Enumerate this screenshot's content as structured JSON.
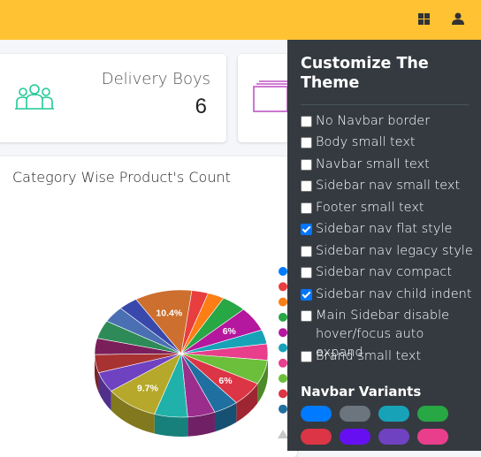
{
  "navbar": {
    "icons": [
      "apps-grid-icon",
      "user-icon"
    ],
    "color": "#ffc233"
  },
  "stats": [
    {
      "title": "Delivery Boys",
      "value": "6",
      "icon": "users-group-icon",
      "icon_color": "#20c997"
    },
    {
      "title": "",
      "value": "",
      "icon": "folder-stack-icon",
      "icon_color": "#c057c6"
    }
  ],
  "chart": {
    "title": "Category Wise Product's Count"
  },
  "chart_data": {
    "type": "pie",
    "title": "Category Wise Product's Count",
    "labels_shown": [
      "10.4%",
      "6%",
      "9.7%",
      "6%"
    ],
    "slices": [
      {
        "value": 10.4,
        "color": "#cd6f2e",
        "label": "10.4%"
      },
      {
        "value": 3.0,
        "color": "#e83e3e",
        "label": ""
      },
      {
        "value": 3.0,
        "color": "#fd7e14",
        "label": ""
      },
      {
        "value": 4.5,
        "color": "#28a745",
        "label": ""
      },
      {
        "value": 6.0,
        "color": "#b5179e",
        "label": "6%"
      },
      {
        "value": 3.5,
        "color": "#17a2b8",
        "label": ""
      },
      {
        "value": 4.0,
        "color": "#e83e8c",
        "label": ""
      },
      {
        "value": 6.0,
        "color": "#6bbf3a",
        "label": ""
      },
      {
        "value": 6.0,
        "color": "#dc3545",
        "label": "6%"
      },
      {
        "value": 4.5,
        "color": "#1f6fa0",
        "label": ""
      },
      {
        "value": 5.0,
        "color": "#9b2d8c",
        "label": ""
      },
      {
        "value": 6.0,
        "color": "#20b2aa",
        "label": ""
      },
      {
        "value": 9.7,
        "color": "#b5a82a",
        "label": "9.7%"
      },
      {
        "value": 5.0,
        "color": "#6f42c1",
        "label": ""
      },
      {
        "value": 4.5,
        "color": "#a83232",
        "label": ""
      },
      {
        "value": 4.0,
        "color": "#7a1f5a",
        "label": ""
      },
      {
        "value": 4.5,
        "color": "#2e8b57",
        "label": ""
      },
      {
        "value": 4.0,
        "color": "#4a6fb3",
        "label": ""
      },
      {
        "value": 3.5,
        "color": "#3949ab",
        "label": ""
      }
    ],
    "legend_colors": [
      "#007bff",
      "#e83e3e",
      "#fd7e14",
      "#28a745",
      "#b5179e",
      "#17a2b8",
      "#e83e8c",
      "#6bbf3a",
      "#dc3545",
      "#1f6fa0"
    ]
  },
  "sidebar": {
    "title": "Customize The Theme",
    "options": [
      {
        "label": "No Navbar border",
        "checked": false
      },
      {
        "label": "Body small text",
        "checked": false
      },
      {
        "label": "Navbar small text",
        "checked": false
      },
      {
        "label": "Sidebar nav small text",
        "checked": false
      },
      {
        "label": "Footer small text",
        "checked": false
      },
      {
        "label": "Sidebar nav flat style",
        "checked": true
      },
      {
        "label": "Sidebar nav legacy style",
        "checked": false
      },
      {
        "label": "Sidebar nav compact",
        "checked": false
      },
      {
        "label": "Sidebar nav child indent",
        "checked": true
      },
      {
        "label": "Main Sidebar disable hover/focus auto expand",
        "checked": false
      },
      {
        "label": "Brand small text",
        "checked": false
      }
    ],
    "variants_title": "Navbar Variants",
    "variant_colors": [
      "#007bff",
      "#6c757d",
      "#17a2b8",
      "#28a745",
      "#dc3545",
      "#6610f2",
      "#6f42c1",
      "#e83e8c"
    ]
  }
}
